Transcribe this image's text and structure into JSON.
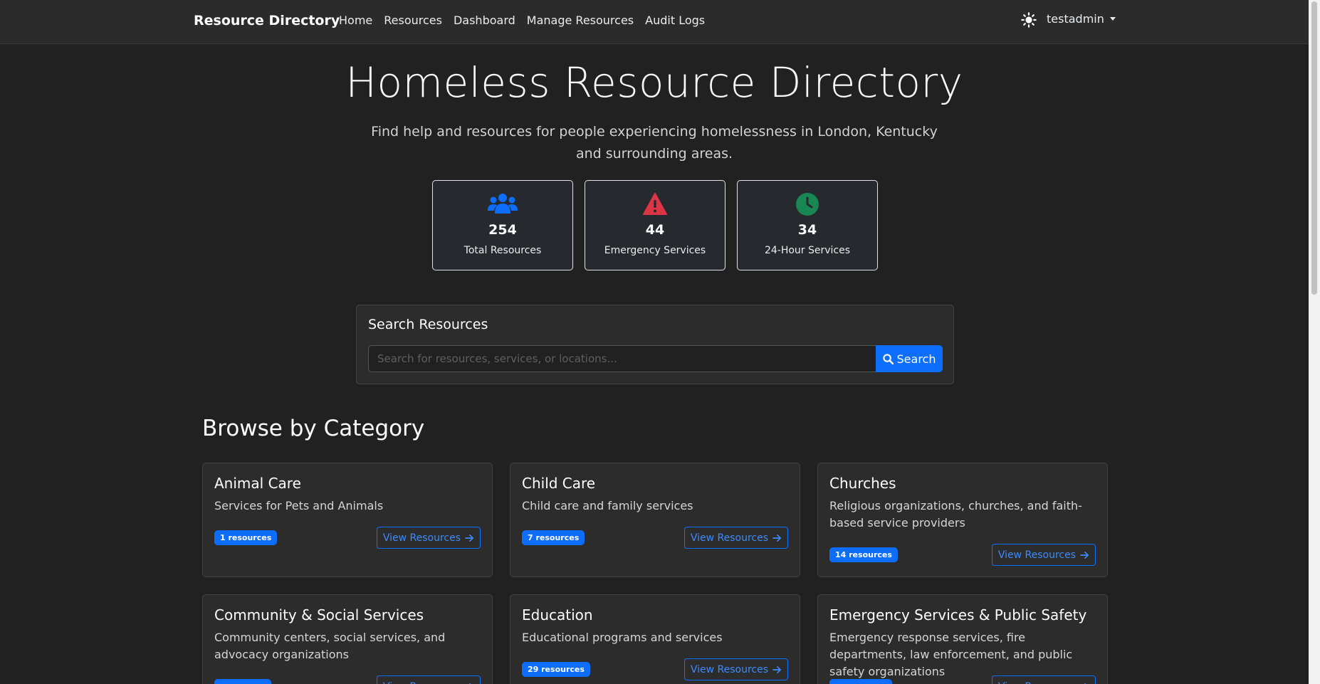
{
  "navbar": {
    "brand": "Resource Directory",
    "links": [
      "Home",
      "Resources",
      "Dashboard",
      "Manage Resources",
      "Audit Logs"
    ],
    "user": "testadmin"
  },
  "hero": {
    "title": "Homeless Resource Directory",
    "subtitle": "Find help and resources for people experiencing homelessness in London, Kentucky and surrounding areas."
  },
  "stats": [
    {
      "icon": "users-icon",
      "value": "254",
      "label": "Total Resources",
      "color": "#0d6efd"
    },
    {
      "icon": "warning-icon",
      "value": "44",
      "label": "Emergency Services",
      "color": "#dc3545"
    },
    {
      "icon": "clock-icon",
      "value": "34",
      "label": "24-Hour Services",
      "color": "#198754"
    }
  ],
  "search": {
    "title": "Search Resources",
    "placeholder": "Search for resources, services, or locations...",
    "button": "Search"
  },
  "browse": {
    "title": "Browse by Category",
    "view_label": "View Resources",
    "categories": [
      {
        "name": "Animal Care",
        "description": "Services for Pets and Animals",
        "count": "1 resources"
      },
      {
        "name": "Child Care",
        "description": "Child care and family services",
        "count": "7 resources"
      },
      {
        "name": "Churches",
        "description": "Religious organizations, churches, and faith-based service providers",
        "count": "14 resources"
      },
      {
        "name": "Community & Social Services",
        "description": "Community centers, social services, and advocacy organizations",
        "count": ""
      },
      {
        "name": "Education",
        "description": "Educational programs and services",
        "count": "29 resources"
      },
      {
        "name": "Emergency Services & Public Safety",
        "description": "Emergency response services, fire departments, law enforcement, and public safety organizations",
        "count": ""
      }
    ]
  },
  "colors": {
    "accent": "#0d6efd",
    "background": "#212121",
    "card": "#2c2c2c"
  }
}
